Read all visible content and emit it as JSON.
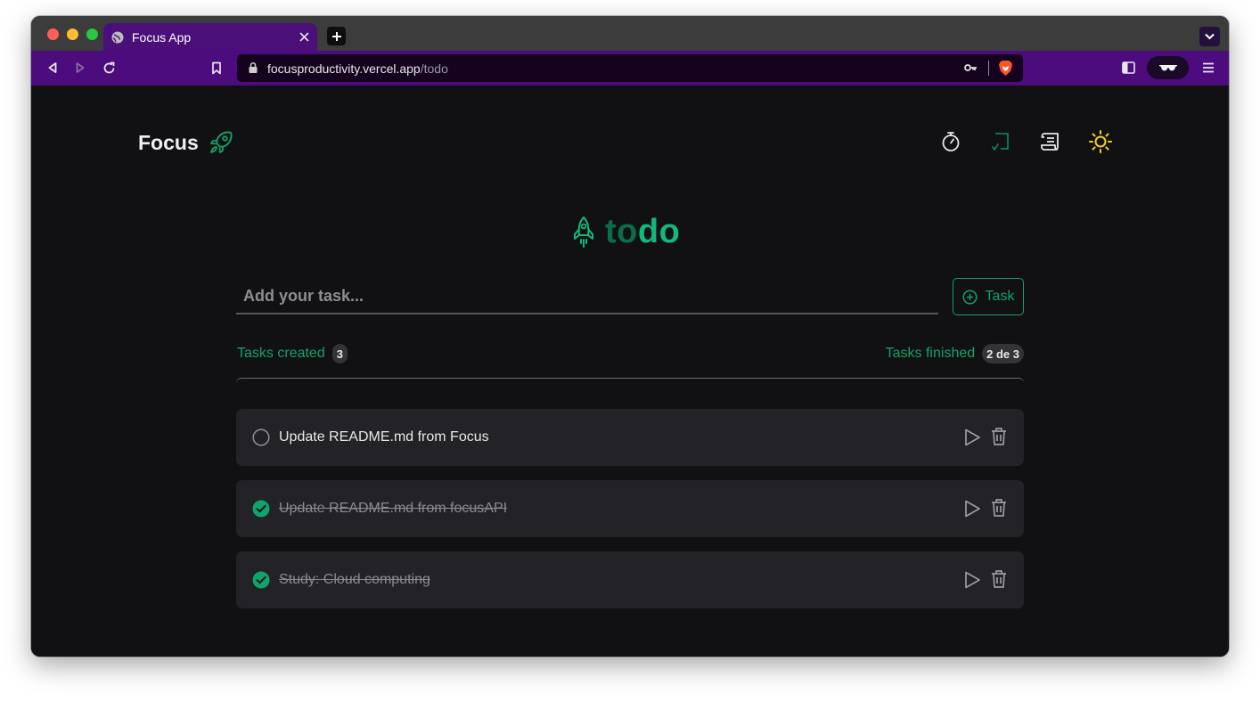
{
  "browser": {
    "tab_title": "Focus App",
    "url_host": "focusproductivity.vercel.app",
    "url_path": "/todo",
    "accent_color": "#4c0c7e"
  },
  "app": {
    "brand": "Focus",
    "nav_icons": [
      "stopwatch-icon",
      "todo-checklist-icon",
      "scroll-notes-icon",
      "sun-icon"
    ],
    "hero_to": "to",
    "hero_do": "do",
    "input_placeholder": "Add your task...",
    "add_button_label": "Task",
    "tasks_created_label": "Tasks created",
    "tasks_created_count": "3",
    "tasks_finished_label": "Tasks finished",
    "tasks_finished_count": "2 de 3",
    "tasks": [
      {
        "text": "Update README.md from Focus",
        "done": false
      },
      {
        "text": "Update README.md from focusAPI",
        "done": true
      },
      {
        "text": "Study: Cloud computing",
        "done": true
      }
    ],
    "colors": {
      "green": "#14b87a",
      "dark_green": "#0b6d4a",
      "sun": "#f2d21b"
    }
  }
}
